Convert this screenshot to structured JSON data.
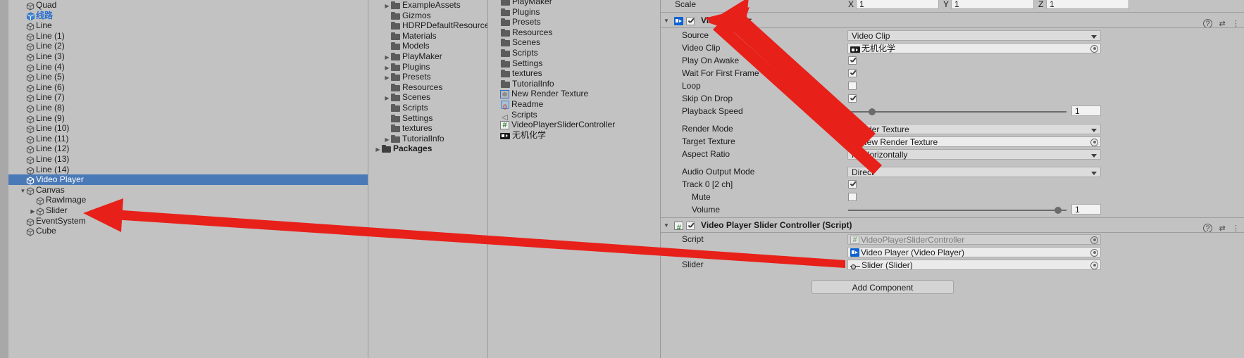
{
  "hierarchy": {
    "items": [
      {
        "label": "Quad",
        "indent": 1,
        "twisty": "",
        "icon": "gameobject-icon",
        "style": "normal"
      },
      {
        "label": "线路",
        "indent": 1,
        "twisty": "",
        "icon": "prefab-icon",
        "style": "blue"
      },
      {
        "label": "Line",
        "indent": 1,
        "twisty": "",
        "icon": "gameobject-icon",
        "style": "normal"
      },
      {
        "label": "Line (1)",
        "indent": 1,
        "twisty": "",
        "icon": "gameobject-icon",
        "style": "normal"
      },
      {
        "label": "Line (2)",
        "indent": 1,
        "twisty": "",
        "icon": "gameobject-icon",
        "style": "normal"
      },
      {
        "label": "Line (3)",
        "indent": 1,
        "twisty": "",
        "icon": "gameobject-icon",
        "style": "normal"
      },
      {
        "label": "Line (4)",
        "indent": 1,
        "twisty": "",
        "icon": "gameobject-icon",
        "style": "normal"
      },
      {
        "label": "Line (5)",
        "indent": 1,
        "twisty": "",
        "icon": "gameobject-icon",
        "style": "normal"
      },
      {
        "label": "Line (6)",
        "indent": 1,
        "twisty": "",
        "icon": "gameobject-icon",
        "style": "normal"
      },
      {
        "label": "Line (7)",
        "indent": 1,
        "twisty": "",
        "icon": "gameobject-icon",
        "style": "normal"
      },
      {
        "label": "Line (8)",
        "indent": 1,
        "twisty": "",
        "icon": "gameobject-icon",
        "style": "normal"
      },
      {
        "label": "Line (9)",
        "indent": 1,
        "twisty": "",
        "icon": "gameobject-icon",
        "style": "normal"
      },
      {
        "label": "Line (10)",
        "indent": 1,
        "twisty": "",
        "icon": "gameobject-icon",
        "style": "normal"
      },
      {
        "label": "Line (11)",
        "indent": 1,
        "twisty": "",
        "icon": "gameobject-icon",
        "style": "normal"
      },
      {
        "label": "Line (12)",
        "indent": 1,
        "twisty": "",
        "icon": "gameobject-icon",
        "style": "normal"
      },
      {
        "label": "Line (13)",
        "indent": 1,
        "twisty": "",
        "icon": "gameobject-icon",
        "style": "normal"
      },
      {
        "label": "Line (14)",
        "indent": 1,
        "twisty": "",
        "icon": "gameobject-icon",
        "style": "normal"
      },
      {
        "label": "Video Player",
        "indent": 1,
        "twisty": "",
        "icon": "gameobject-icon",
        "style": "selected"
      },
      {
        "label": "Canvas",
        "indent": 1,
        "twisty": "▼",
        "icon": "gameobject-icon",
        "style": "normal"
      },
      {
        "label": "RawImage",
        "indent": 2,
        "twisty": "",
        "icon": "gameobject-icon",
        "style": "normal"
      },
      {
        "label": "Slider",
        "indent": 2,
        "twisty": "▶",
        "icon": "gameobject-icon",
        "style": "normal"
      },
      {
        "label": "EventSystem",
        "indent": 1,
        "twisty": "",
        "icon": "gameobject-icon",
        "style": "normal"
      },
      {
        "label": "Cube",
        "indent": 1,
        "twisty": "",
        "icon": "gameobject-icon",
        "style": "normal"
      }
    ]
  },
  "project_tree": {
    "items": [
      {
        "label": "ExampleAssets",
        "twisty": "▶",
        "indent": 1,
        "bold": false
      },
      {
        "label": "Gizmos",
        "twisty": "",
        "indent": 1,
        "bold": false
      },
      {
        "label": "HDRPDefaultResources",
        "twisty": "",
        "indent": 1,
        "bold": false
      },
      {
        "label": "Materials",
        "twisty": "",
        "indent": 1,
        "bold": false
      },
      {
        "label": "Models",
        "twisty": "",
        "indent": 1,
        "bold": false
      },
      {
        "label": "PlayMaker",
        "twisty": "▶",
        "indent": 1,
        "bold": false
      },
      {
        "label": "Plugins",
        "twisty": "▶",
        "indent": 1,
        "bold": false
      },
      {
        "label": "Presets",
        "twisty": "▶",
        "indent": 1,
        "bold": false
      },
      {
        "label": "Resources",
        "twisty": "",
        "indent": 1,
        "bold": false
      },
      {
        "label": "Scenes",
        "twisty": "▶",
        "indent": 1,
        "bold": false
      },
      {
        "label": "Scripts",
        "twisty": "",
        "indent": 1,
        "bold": false
      },
      {
        "label": "Settings",
        "twisty": "",
        "indent": 1,
        "bold": false
      },
      {
        "label": "textures",
        "twisty": "",
        "indent": 1,
        "bold": false
      },
      {
        "label": "TutorialInfo",
        "twisty": "▶",
        "indent": 1,
        "bold": false
      },
      {
        "label": "Packages",
        "twisty": "▶",
        "indent": 0,
        "bold": true
      }
    ]
  },
  "project_list": {
    "items": [
      {
        "label": "PlayMaker",
        "icon": "folder-icon"
      },
      {
        "label": "Plugins",
        "icon": "folder-icon"
      },
      {
        "label": "Presets",
        "icon": "folder-icon"
      },
      {
        "label": "Resources",
        "icon": "folder-icon"
      },
      {
        "label": "Scenes",
        "icon": "folder-icon"
      },
      {
        "label": "Scripts",
        "icon": "folder-icon"
      },
      {
        "label": "Settings",
        "icon": "folder-icon"
      },
      {
        "label": "textures",
        "icon": "folder-icon"
      },
      {
        "label": "TutorialInfo",
        "icon": "folder-icon"
      },
      {
        "label": "New Render Texture",
        "icon": "render-texture-icon"
      },
      {
        "label": "Readme",
        "icon": "prefab-icon"
      },
      {
        "label": "Scripts",
        "icon": "mesh-icon"
      },
      {
        "label": "VideoPlayerSliderController",
        "icon": "csharp-script-icon"
      },
      {
        "label": "无机化学",
        "icon": "video-clip-icon"
      }
    ]
  },
  "inspector": {
    "transform_tail": {
      "scale_label": "Scale",
      "axis_x": "X",
      "axis_x_value": "1",
      "axis_y": "Y",
      "axis_y_value": "1",
      "axis_z": "Z",
      "axis_z_value": "1"
    },
    "video_player": {
      "header_title": "Video Player",
      "header_enabled": true,
      "help_icon": "help-icon",
      "preset_icon": "preset-icon",
      "menu_icon": "kebab-menu-icon",
      "rows": [
        {
          "label": "Source",
          "type": "popup",
          "value": "Video Clip"
        },
        {
          "label": "Video Clip",
          "type": "object",
          "value": "无机化学",
          "icon": "video-clip-icon"
        },
        {
          "label": "Play On Awake",
          "type": "checkbox",
          "value": true
        },
        {
          "label": "Wait For First Frame",
          "type": "checkbox",
          "value": true
        },
        {
          "label": "Loop",
          "type": "checkbox",
          "value": false
        },
        {
          "label": "Skip On Drop",
          "type": "checkbox",
          "value": true
        },
        {
          "label": "Playback Speed",
          "type": "slider",
          "value": "1",
          "fraction": 0.11
        },
        {
          "label": "Render Mode",
          "type": "popup",
          "value": "Render Texture"
        },
        {
          "label": "Target Texture",
          "type": "object",
          "value": "New Render Texture",
          "icon": "render-texture-icon"
        },
        {
          "label": "Aspect Ratio",
          "type": "popup",
          "value": "Fit Horizontally"
        },
        {
          "label": "Audio Output Mode",
          "type": "popup",
          "value": "Direct"
        },
        {
          "label": "Track 0 [2 ch]",
          "type": "checkbox",
          "value": true
        },
        {
          "label": "Mute",
          "type": "checkbox",
          "value": false,
          "indent": true
        },
        {
          "label": "Volume",
          "type": "slider",
          "value": "1",
          "fraction": 0.96,
          "indent": true
        }
      ]
    },
    "slider_controller": {
      "header_title": "Video Player Slider Controller (Script)",
      "header_enabled": true,
      "script_icon": "csharp-script-icon",
      "help_icon": "help-icon",
      "preset_icon": "preset-icon",
      "menu_icon": "kebab-menu-icon",
      "rows": [
        {
          "label": "Script",
          "type": "object",
          "value": "VideoPlayerSliderController",
          "disabled": true,
          "icon": "csharp-script-icon"
        },
        {
          "label": "",
          "type": "object",
          "value": "Video Player (Video Player)",
          "icon": "video-player-icon"
        },
        {
          "label": "Slider",
          "type": "object",
          "value": "Slider (Slider)",
          "icon": "slider-icon"
        }
      ]
    },
    "add_component_label": "Add Component"
  },
  "annotations": {
    "arrow_color": "#e8201a",
    "arrow_1_target": "Video Player component header",
    "arrow_2_target": "Slider hierarchy item"
  },
  "colors": {
    "background": "#c2c2c2",
    "selection": "#4a79b8",
    "divider": "#999999",
    "accent_blue": "#2b6fd0"
  }
}
